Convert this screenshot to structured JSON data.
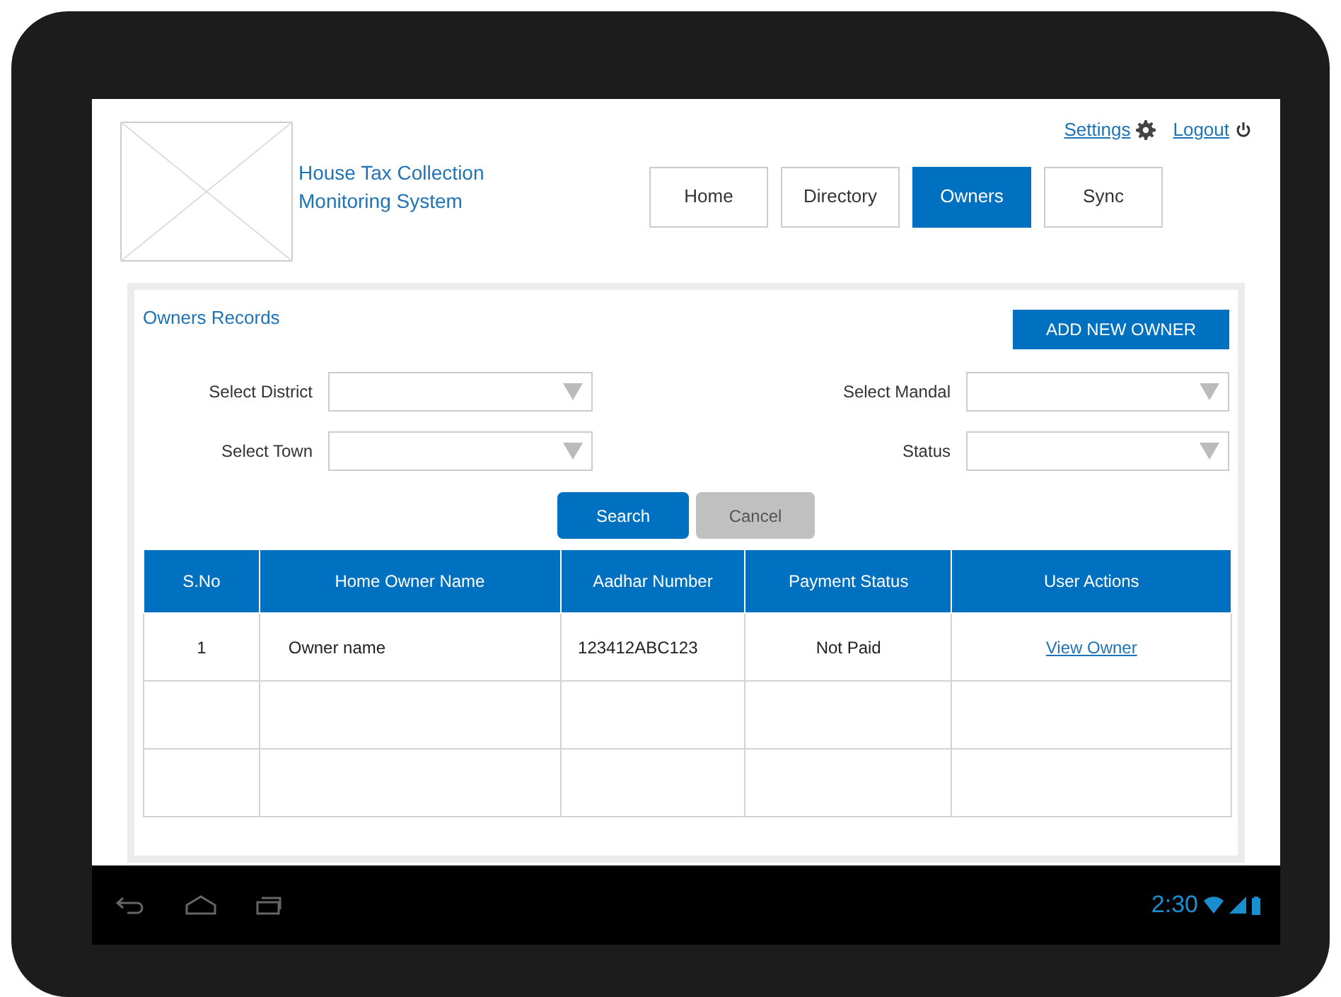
{
  "header": {
    "title": "House Tax Collection Monitoring System",
    "links": [
      {
        "label": "Settings",
        "kind": "settings"
      },
      {
        "label": "Logout",
        "kind": "logout"
      }
    ]
  },
  "tabs": [
    {
      "label": "Home",
      "selected": false
    },
    {
      "label": "Directory",
      "selected": false
    },
    {
      "label": "Owners",
      "selected": true
    },
    {
      "label": "Sync",
      "selected": false
    }
  ],
  "panel": {
    "title": "Owners Records",
    "add_button": "ADD NEW OWNER",
    "filters": [
      {
        "label": "Select District"
      },
      {
        "label": "Select Mandal"
      },
      {
        "label": "Select Town"
      },
      {
        "label": "Status"
      }
    ],
    "buttons": [
      {
        "label": "Search",
        "disabled": false
      },
      {
        "label": "Cancel",
        "disabled": true
      }
    ]
  },
  "table": {
    "columns": [
      {
        "label": "S.No",
        "kind": "text"
      },
      {
        "label": "Home Owner Name",
        "kind": "text"
      },
      {
        "label": "Aadhar Number",
        "kind": "text"
      },
      {
        "label": "Payment Status",
        "kind": "text"
      },
      {
        "label": "User Actions",
        "kind": "link"
      }
    ],
    "rows": [
      {
        "kind": "data",
        "cells": [
          "1",
          "Owner name",
          "123412ABC123",
          "Not Paid",
          "View Owner"
        ]
      },
      {
        "kind": "blank"
      },
      {
        "kind": "blank"
      }
    ]
  },
  "status_bar": {
    "time": "2:30"
  }
}
